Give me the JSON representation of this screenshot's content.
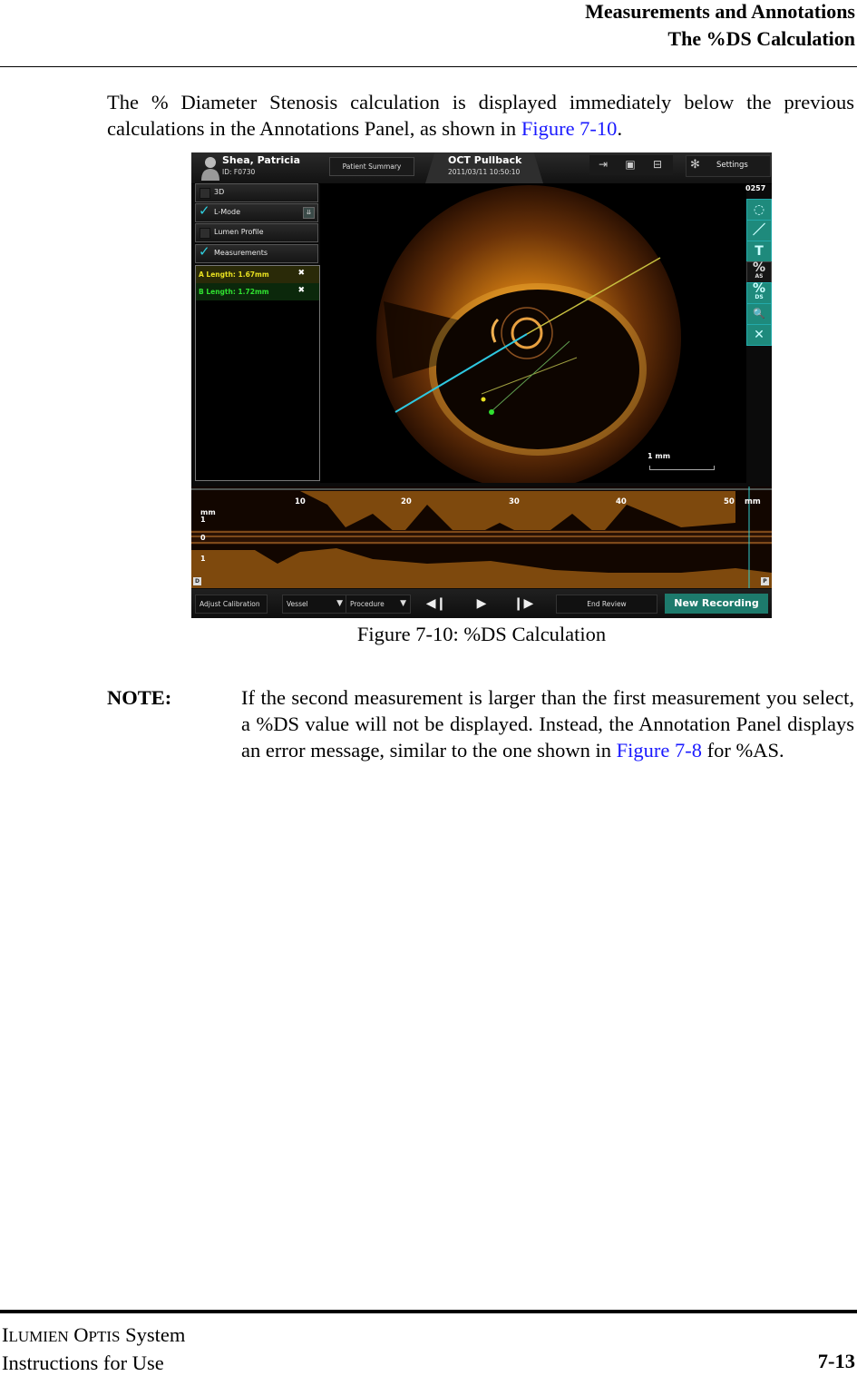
{
  "header": {
    "line1": "Measurements and Annotations",
    "line2": "The %DS Calculation"
  },
  "intro": {
    "text_before": "The % Diameter Stenosis calculation is displayed immediately below the previous calculations in the Annotations Panel, as shown in ",
    "link": "Figure 7-10",
    "text_after": "."
  },
  "figure": {
    "caption": "Figure 7-10:  %DS Calculation",
    "app": {
      "patient_name": "Shea, Patricia",
      "patient_id": "ID: F0730",
      "patient_summary_button": "Patient Summary",
      "mode_title": "OCT Pullback",
      "datetime": "2011/03/11 10:50:10",
      "toolbar_icons": [
        "export-icon",
        "camera-icon",
        "print-icon"
      ],
      "settings_label": "Settings",
      "frame_number": "0257",
      "options": [
        {
          "label": "3D",
          "checked": false
        },
        {
          "label": "L-Mode",
          "checked": true,
          "has_dropdown": true
        },
        {
          "label": "Lumen Profile",
          "checked": false
        },
        {
          "label": "Measurements",
          "checked": true
        }
      ],
      "measurements": [
        {
          "label": "A Length: 1.67mm",
          "color": "#e8e020"
        },
        {
          "label": "B Length: 1.72mm",
          "color": "#30e030"
        }
      ],
      "right_tools": [
        {
          "name": "area-tool",
          "glyph": "◌",
          "sub": ""
        },
        {
          "name": "length-tool",
          "glyph": "／",
          "sub": ""
        },
        {
          "name": "text-tool",
          "glyph": "T",
          "sub": ""
        },
        {
          "name": "percent-as-tool",
          "glyph": "%",
          "sub": "AS"
        },
        {
          "name": "percent-ds-tool",
          "glyph": "%",
          "sub": "DS"
        },
        {
          "name": "zoom-tool",
          "glyph": "🔍",
          "sub": ""
        },
        {
          "name": "clear-tool",
          "glyph": "✕",
          "sub": ""
        }
      ],
      "scale_label": "1 mm",
      "lmode": {
        "ticks": [
          "10",
          "20",
          "30",
          "40",
          "50"
        ],
        "unit": "mm",
        "axis_unit": "mm",
        "axis_labels": [
          "1",
          "0",
          "1"
        ],
        "distal_marker": "D",
        "proximal_marker": "P"
      },
      "bottom": {
        "adjust_calibration": "Adjust Calibration",
        "vessel": "Vessel",
        "procedure": "Procedure",
        "prev_frame": "◀❙",
        "play": "▶",
        "next_frame": "❙▶",
        "end_review": "End Review",
        "new_recording": "New Recording"
      },
      "colors": {
        "accent_teal": "#1d7a6c",
        "measurement_a": "#e8e020",
        "measurement_b": "#30e030",
        "cyan_line": "#2ec8e0"
      }
    }
  },
  "note": {
    "label": "NOTE:",
    "text_before": "If the second measurement is larger than the first measurement you select, a %DS value will not be displayed. Instead, the Annotation Panel displays an error message, similar to the one shown in ",
    "link": "Figure 7-8",
    "text_after": " for %AS."
  },
  "footer": {
    "product_a_first": "I",
    "product_a_rest": "LUMIEN",
    "product_b_first": "O",
    "product_b_rest": "PTIS",
    "product_suffix": " System",
    "line2": "Instructions for Use",
    "page": "7-13"
  }
}
